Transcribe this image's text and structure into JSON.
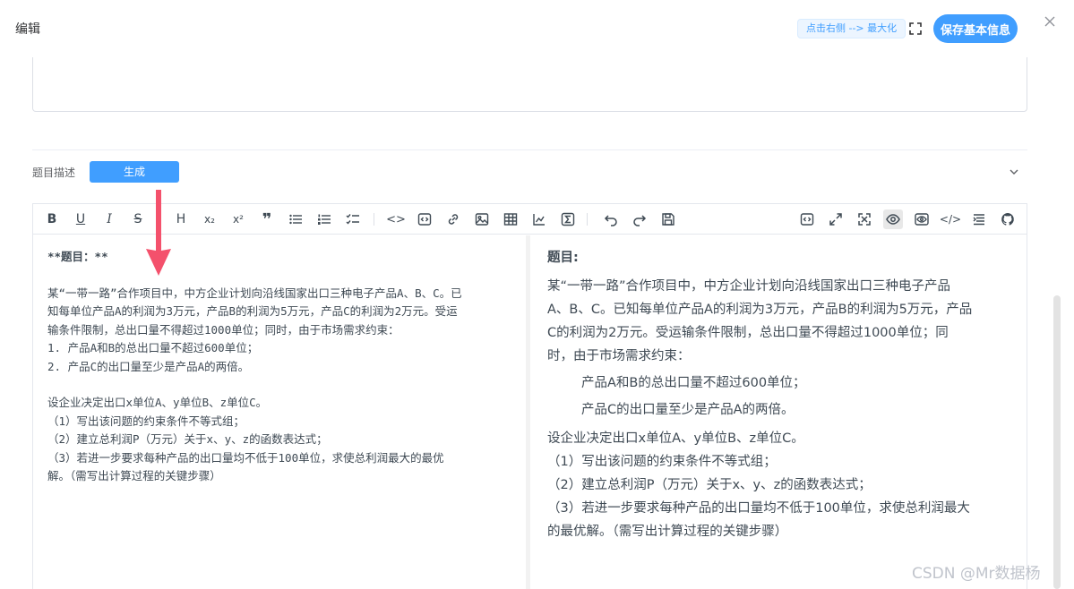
{
  "dialog": {
    "title": "编辑",
    "hint": "点击右侧 --> 最大化",
    "save_label": "保存基本信息"
  },
  "description": {
    "label": "题目描述",
    "generate_label": "生成"
  },
  "editor": {
    "source_lines": [
      "**题目：**",
      "",
      "某“一带一路”合作项目中，中方企业计划向沿线国家出口三种电子产品A、B、C。已",
      "知每单位产品A的利润为3万元，产品B的利润为5万元，产品C的利润为2万元。受运",
      "输条件限制，总出口量不得超过1000单位；同时，由于市场需求约束：",
      "1. 产品A和B的总出口量不超过600单位；",
      "2. 产品C的出口量至少是产品A的两倍。",
      "",
      "设企业决定出口x单位A、y单位B、z单位C。",
      "（1）写出该问题的约束条件不等式组；",
      "（2）建立总利润P（万元）关于x、y、z的函数表达式；",
      "（3）若进一步要求每种产品的出口量均不低于100单位，求使总利润最大的最优",
      "解。（需写出计算过程的关键步骤）"
    ],
    "preview": {
      "heading": "题目:",
      "para1_lines": [
        "某“一带一路”合作项目中，中方企业计划向沿线国家出口三种电子产品",
        "A、B、C。已知每单位产品A的利润为3万元，产品B的利润为5万元，产品",
        "C的利润为2万元。受运输条件限制，总出口量不得超过1000单位；同",
        "时，由于市场需求约束："
      ],
      "list": [
        "产品A和B的总出口量不超过600单位；",
        "产品C的出口量至少是产品A的两倍。"
      ],
      "para2_lines": [
        "设企业决定出口x单位A、y单位B、z单位C。",
        "（1）写出该问题的约束条件不等式组；",
        "（2）建立总利润P（万元）关于x、y、z的函数表达式；",
        "（3）若进一步要求每种产品的出口量均不低于100单位，求使总利润最大",
        "的最优解。（需写出计算过程的关键步骤）"
      ]
    }
  },
  "watermark": "CSDN @Mr数据杨",
  "colors": {
    "primary": "#409eff",
    "arrow": "#f4516c"
  }
}
